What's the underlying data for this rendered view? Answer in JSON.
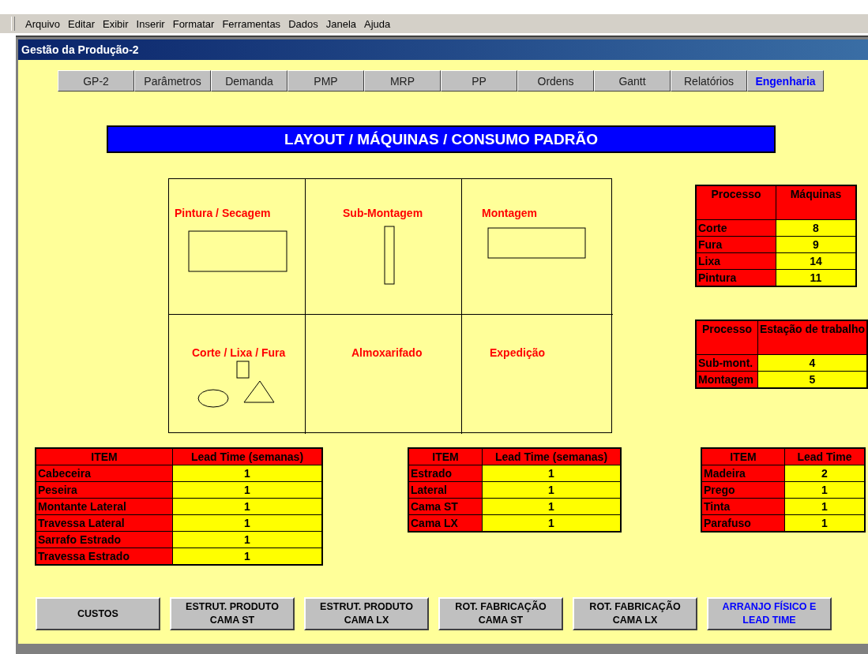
{
  "menu": [
    {
      "label": "Arquivo"
    },
    {
      "label": "Editar"
    },
    {
      "label": "Exibir"
    },
    {
      "label": "Inserir"
    },
    {
      "label": "Formatar"
    },
    {
      "label": "Ferramentas"
    },
    {
      "label": "Dados"
    },
    {
      "label": "Janela"
    },
    {
      "label": "Ajuda"
    }
  ],
  "window": {
    "title": "Gestão da Produção-2"
  },
  "tabs": [
    {
      "label": "GP-2",
      "selected": false
    },
    {
      "label": "Parâmetros",
      "selected": false
    },
    {
      "label": "Demanda",
      "selected": false
    },
    {
      "label": "PMP",
      "selected": false
    },
    {
      "label": "MRP",
      "selected": false
    },
    {
      "label": "PP",
      "selected": false
    },
    {
      "label": "Ordens",
      "selected": false
    },
    {
      "label": "Gantt",
      "selected": false
    },
    {
      "label": "Relatórios",
      "selected": false
    },
    {
      "label": "Engenharia",
      "selected": true
    }
  ],
  "banner": "LAYOUT / MÁQUINAS / CONSUMO PADRÃO",
  "floor_plan": {
    "areas": [
      "Pintura / Secagem",
      "Sub-Montagem",
      "Montagem",
      "Corte / Lixa / Fura",
      "Almoxarifado",
      "Expedição"
    ]
  },
  "side_tables": [
    {
      "columns": [
        "Processo",
        "Máquinas"
      ],
      "rows": [
        [
          "Corte",
          "8"
        ],
        [
          "Fura",
          "9"
        ],
        [
          "Lixa",
          "14"
        ],
        [
          "Pintura",
          "11"
        ]
      ]
    },
    {
      "columns": [
        "Processo",
        "Estação de trabalho"
      ],
      "rows": [
        [
          "Sub-mont.",
          "4"
        ],
        [
          "Montagem",
          "5"
        ]
      ]
    }
  ],
  "lead_tables": [
    {
      "columns": [
        "ITEM",
        "Lead Time (semanas)"
      ],
      "rows": [
        [
          "Cabeceira",
          "1"
        ],
        [
          "Peseira",
          "1"
        ],
        [
          "Montante Lateral",
          "1"
        ],
        [
          "Travessa Lateral",
          "1"
        ],
        [
          "Sarrafo Estrado",
          "1"
        ],
        [
          "Travessa Estrado",
          "1"
        ]
      ]
    },
    {
      "columns": [
        "ITEM",
        "Lead Time (semanas)"
      ],
      "rows": [
        [
          "Estrado",
          "1"
        ],
        [
          "Lateral",
          "1"
        ],
        [
          "Cama ST",
          "1"
        ],
        [
          "Cama LX",
          "1"
        ]
      ]
    },
    {
      "columns": [
        "ITEM",
        "Lead Time"
      ],
      "rows": [
        [
          "Madeira",
          "2"
        ],
        [
          "Prego",
          "1"
        ],
        [
          "Tinta",
          "1"
        ],
        [
          "Parafuso",
          "1"
        ]
      ]
    }
  ],
  "buttons": [
    {
      "label": "CUSTOS",
      "selected": false
    },
    {
      "label": "ESTRUT. PRODUTO\nCAMA ST",
      "selected": false
    },
    {
      "label": "ESTRUT.  PRODUTO\nCAMA LX",
      "selected": false
    },
    {
      "label": "ROT. FABRICAÇÃO\nCAMA ST",
      "selected": false
    },
    {
      "label": "ROT. FABRICAÇÃO\nCAMA LX",
      "selected": false
    },
    {
      "label": "ARRANJO FÍSICO E\nLEAD TIME",
      "selected": true
    }
  ]
}
